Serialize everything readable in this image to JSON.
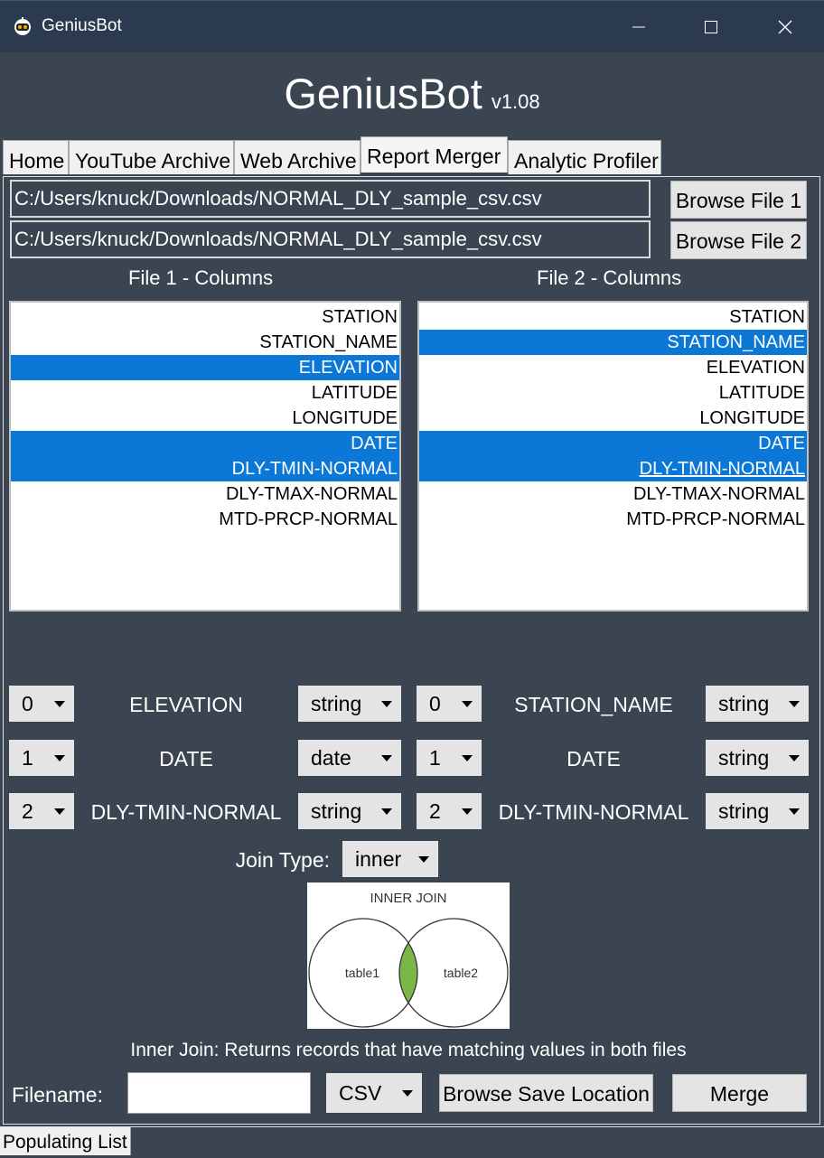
{
  "window": {
    "title": "GeniusBot",
    "icon": "robot-logo-icon"
  },
  "header": {
    "title": "GeniusBot",
    "version": "v1.08"
  },
  "tabs": [
    {
      "label": "Home"
    },
    {
      "label": "YouTube Archive"
    },
    {
      "label": "Web Archive"
    },
    {
      "label": "Report Merger",
      "active": true
    },
    {
      "label": "Analytic Profiler"
    }
  ],
  "files": {
    "file1_path": "C:/Users/knuck/Downloads/NORMAL_DLY_sample_csv.csv",
    "file2_path": "C:/Users/knuck/Downloads/NORMAL_DLY_sample_csv.csv",
    "browse1_label": "Browse File 1",
    "browse2_label": "Browse File 2"
  },
  "columns": {
    "file1_header": "File 1 - Columns",
    "file2_header": "File 2 - Columns",
    "file1_items": [
      {
        "label": "STATION",
        "selected": false
      },
      {
        "label": "STATION_NAME",
        "selected": false
      },
      {
        "label": "ELEVATION",
        "selected": true
      },
      {
        "label": "LATITUDE",
        "selected": false
      },
      {
        "label": "LONGITUDE",
        "selected": false
      },
      {
        "label": "DATE",
        "selected": true
      },
      {
        "label": "DLY-TMIN-NORMAL",
        "selected": true
      },
      {
        "label": "DLY-TMAX-NORMAL",
        "selected": false
      },
      {
        "label": "MTD-PRCP-NORMAL",
        "selected": false
      }
    ],
    "file2_items": [
      {
        "label": "STATION",
        "selected": false
      },
      {
        "label": "STATION_NAME",
        "selected": true
      },
      {
        "label": "ELEVATION",
        "selected": false
      },
      {
        "label": "LATITUDE",
        "selected": false
      },
      {
        "label": "LONGITUDE",
        "selected": false
      },
      {
        "label": "DATE",
        "selected": true
      },
      {
        "label": "DLY-TMIN-NORMAL",
        "selected": true,
        "focused": true
      },
      {
        "label": "DLY-TMAX-NORMAL",
        "selected": false
      },
      {
        "label": "MTD-PRCP-NORMAL",
        "selected": false
      }
    ]
  },
  "mapping": {
    "rows": [
      {
        "idx1": "0",
        "col1": "ELEVATION",
        "type1": "string",
        "idx2": "0",
        "col2": "STATION_NAME",
        "type2": "string"
      },
      {
        "idx1": "1",
        "col1": "DATE",
        "type1": "date",
        "idx2": "1",
        "col2": "DATE",
        "type2": "string"
      },
      {
        "idx1": "2",
        "col1": "DLY-TMIN-NORMAL",
        "type1": "string",
        "idx2": "2",
        "col2": "DLY-TMIN-NORMAL",
        "type2": "string"
      }
    ]
  },
  "join": {
    "label": "Join Type:",
    "value": "inner",
    "diagram_title": "INNER JOIN",
    "left_label": "table1",
    "right_label": "table2",
    "overlap_color": "#7ab648",
    "description": "Inner Join: Returns records that have matching values in both files"
  },
  "output": {
    "filename_label": "Filename:",
    "filename_value": "",
    "format": "CSV",
    "browse_save_label": "Browse Save Location",
    "merge_label": "Merge"
  },
  "status": {
    "text": "Populating List"
  },
  "colors": {
    "background": "#3b4451",
    "titlebar": "#2b3a4e",
    "selection": "#0b78d8"
  }
}
